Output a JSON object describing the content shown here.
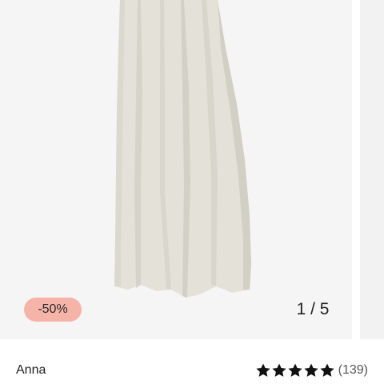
{
  "product": {
    "discount_badge": "-50%",
    "image_counter": "1 / 5",
    "brand": "Anna",
    "rating": {
      "stars": 5,
      "filled": 5,
      "review_count": "(139)",
      "star_color": "#111111"
    },
    "image": {
      "subject": "beige curtain panel",
      "curtain_color": "#e4e2d8",
      "background_color": "#f5f5f5"
    },
    "badge_color": "#f6b3a8"
  }
}
